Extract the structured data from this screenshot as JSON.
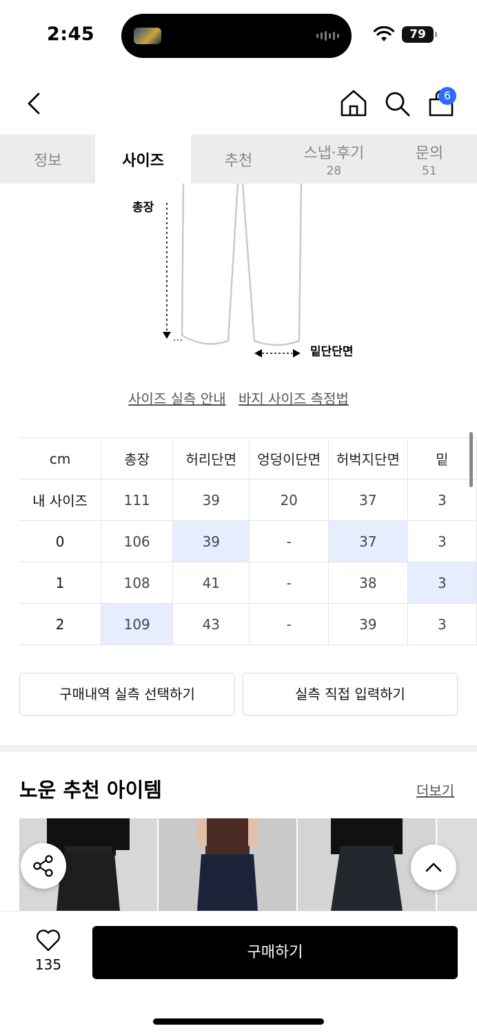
{
  "status": {
    "time": "2:45",
    "battery": "79"
  },
  "header": {
    "cart_count": "6"
  },
  "tabs": [
    {
      "label": "정보",
      "count": ""
    },
    {
      "label": "사이즈",
      "count": ""
    },
    {
      "label": "추천",
      "count": ""
    },
    {
      "label": "스냅·후기",
      "count": "28"
    },
    {
      "label": "문의",
      "count": "51"
    }
  ],
  "diagram": {
    "length_label": "총장",
    "hem_label": "밑단단면"
  },
  "links": {
    "actual_size_guide": "사이즈 실측 안내",
    "pants_measure_method": "바지 사이즈 측정법"
  },
  "size_table": {
    "unit": "cm",
    "columns": [
      "총장",
      "허리단면",
      "엉덩이단면",
      "허벅지단면",
      "밑"
    ],
    "rows": [
      {
        "label": "내 사이즈",
        "values": [
          "111",
          "39",
          "20",
          "37",
          "3"
        ]
      },
      {
        "label": "0",
        "values": [
          "106",
          "39",
          "-",
          "37",
          "3"
        ]
      },
      {
        "label": "1",
        "values": [
          "108",
          "41",
          "-",
          "38",
          "3"
        ]
      },
      {
        "label": "2",
        "values": [
          "109",
          "43",
          "-",
          "39",
          "3"
        ]
      }
    ]
  },
  "actions": {
    "select_purchase": "구매내역 실측 선택하기",
    "manual_input": "실측 직접 입력하기"
  },
  "recommend": {
    "title": "노운 추천 아이템",
    "more": "더보기"
  },
  "bottom": {
    "likes": "135",
    "buy": "구매하기"
  },
  "colors": {
    "accent_blue": "#2e6bff",
    "highlight": "#e6edff",
    "buy_button": "#000000"
  }
}
